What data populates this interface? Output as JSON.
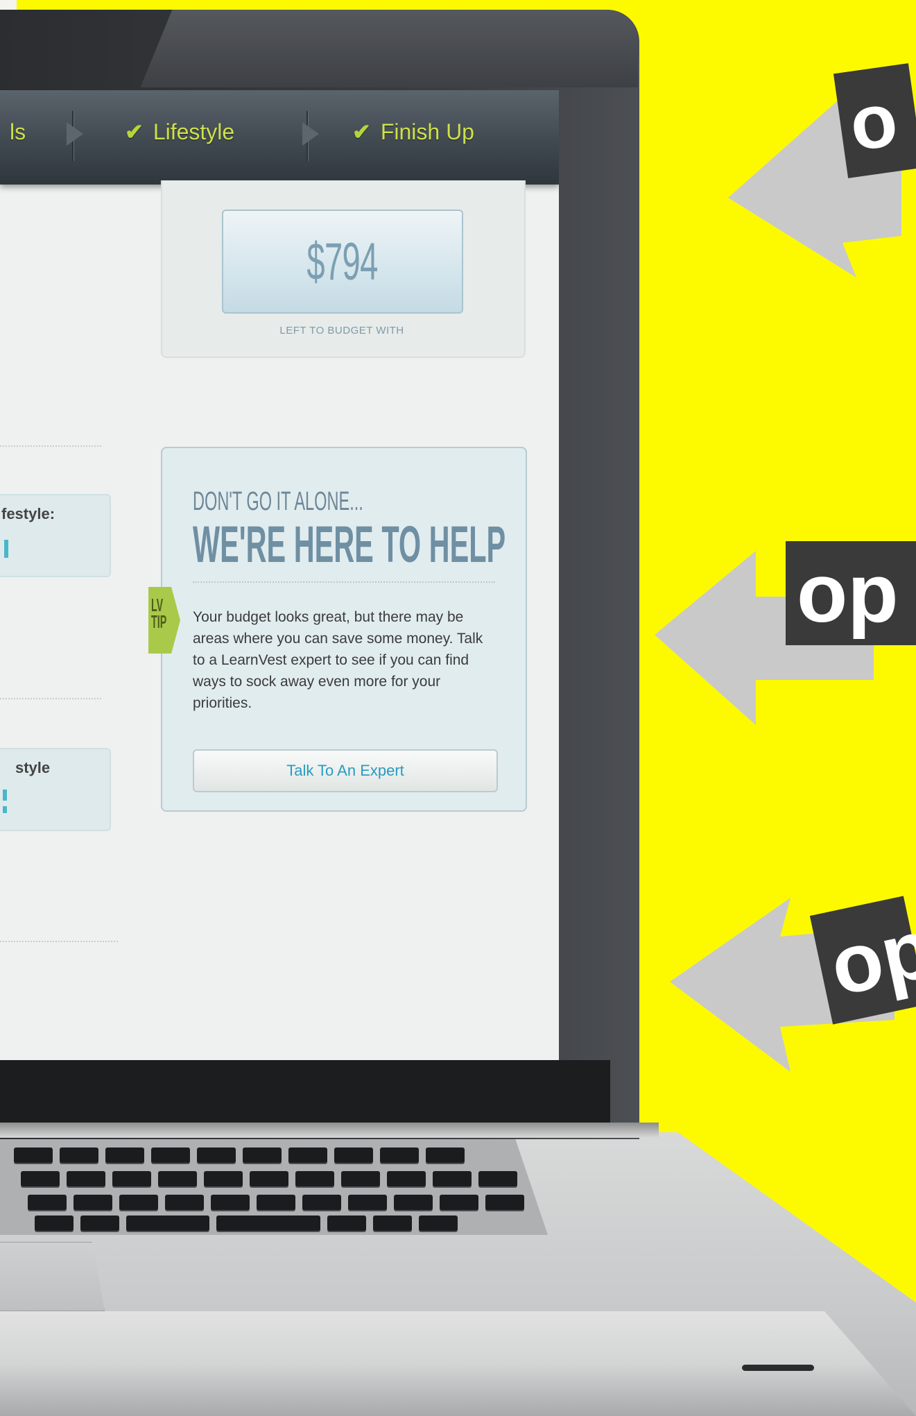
{
  "nav": {
    "partial_label": "ls",
    "items": [
      {
        "label": "Lifestyle"
      },
      {
        "label": "Finish Up"
      }
    ]
  },
  "budget": {
    "amount": "$794",
    "label": "LEFT TO BUDGET WITH"
  },
  "cards": {
    "card1_text": "festyle:",
    "card2_text": "style"
  },
  "help": {
    "kicker": "DON'T GO IT ALONE...",
    "title": "WE'RE HERE TO HELP",
    "tip_badge": "LV TIP",
    "body": "Your budget looks great, but there may be areas where you can save some money. Talk to a LearnVest expert to see if you can find ways to sock away even more for your priorities.",
    "button_label": "Talk To An Expert"
  },
  "signs": [
    "o",
    "op",
    "op"
  ],
  "colors": {
    "background_yellow": "#fdfa00",
    "nav_green": "#cfe04a",
    "button_text": "#2a9bbf",
    "tip_badge_green": "#a9c94a"
  }
}
